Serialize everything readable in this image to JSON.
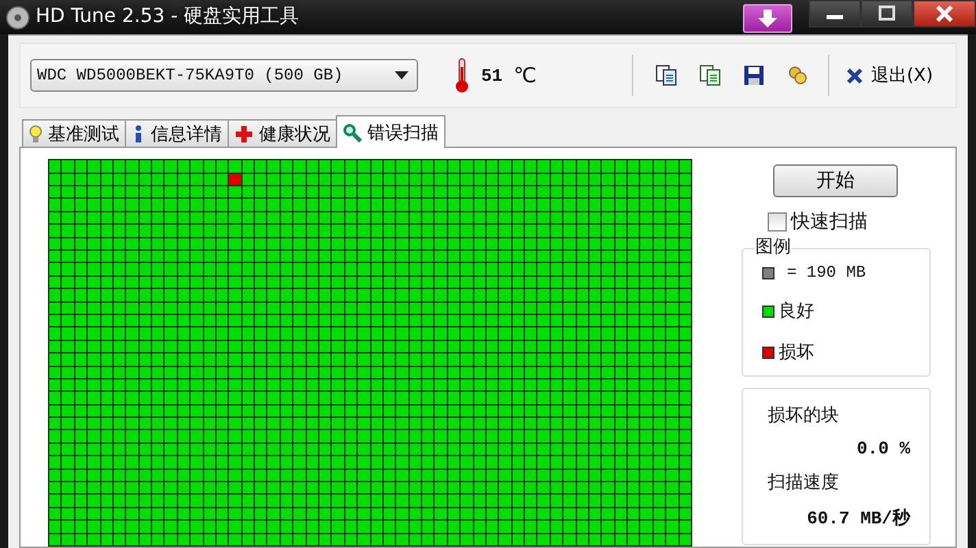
{
  "window": {
    "title": "HD Tune 2.53 - 硬盘实用工具"
  },
  "toolbar": {
    "drive": "WDC WD5000BEKT-75KA9T0 (500 GB)",
    "temperature": "51",
    "temperature_unit": "℃",
    "exit": "退出(X)"
  },
  "tabs": [
    {
      "label": "基准测试",
      "kind": "bulb",
      "selected": false
    },
    {
      "label": "信息详情",
      "kind": "info",
      "selected": false
    },
    {
      "label": "健康状况",
      "kind": "health",
      "selected": false
    },
    {
      "label": "错误扫描",
      "kind": "scan",
      "selected": true
    }
  ],
  "scan": {
    "start_button": "开始",
    "quick_scan": {
      "label": "快速扫描",
      "checked": false
    },
    "legend": {
      "title": "图例",
      "items": [
        {
          "kind": "size",
          "label": "= 190 MB",
          "color": "#808080"
        },
        {
          "kind": "good",
          "label": "良好",
          "color": "#00e000"
        },
        {
          "kind": "damaged",
          "label": "损坏",
          "color": "#e00000"
        }
      ]
    },
    "stats": [
      {
        "label": "损坏的块",
        "value": "0.0 %"
      },
      {
        "label": "扫描速度",
        "value": "60.7 MB/秒"
      }
    ],
    "block_rows": [
      [
        false,
        false,
        false,
        false,
        false,
        false,
        false,
        false,
        false,
        false,
        false,
        false,
        false,
        false,
        false,
        false,
        false,
        false,
        false,
        false,
        false,
        false,
        false,
        false,
        false,
        false,
        false,
        false,
        false,
        false,
        false,
        false,
        false,
        false,
        false,
        false,
        false,
        false,
        false,
        false,
        false,
        false,
        false,
        false,
        false,
        false,
        false,
        false,
        false,
        false
      ],
      [
        false,
        false,
        false,
        false,
        false,
        false,
        false,
        false,
        false,
        false,
        false,
        false,
        false,
        false,
        true,
        false,
        false,
        false,
        false,
        false,
        false,
        false,
        false,
        false,
        false,
        false,
        false,
        false,
        false,
        false,
        false,
        false,
        false,
        false,
        false,
        false,
        false,
        false,
        false,
        false,
        false,
        false,
        false,
        false,
        false,
        false,
        false,
        false,
        false,
        false
      ],
      [
        false,
        false,
        false,
        false,
        false,
        false,
        false,
        false,
        false,
        false,
        false,
        false,
        false,
        false,
        false,
        false,
        false,
        false,
        false,
        false,
        false,
        false,
        false,
        false,
        false,
        false,
        false,
        false,
        false,
        false,
        false,
        false,
        false,
        false,
        false,
        false,
        false,
        false,
        false,
        false,
        false,
        false,
        false,
        false,
        false,
        false,
        false,
        false,
        false,
        false
      ],
      [
        false,
        false,
        false,
        false,
        false,
        false,
        false,
        false,
        false,
        false,
        false,
        false,
        false,
        false,
        false,
        false,
        false,
        false,
        false,
        false,
        false,
        false,
        false,
        false,
        false,
        false,
        false,
        false,
        false,
        false,
        false,
        false,
        false,
        false,
        false,
        false,
        false,
        false,
        false,
        false,
        false,
        false,
        false,
        false,
        false,
        false,
        false,
        false,
        false,
        false
      ],
      [
        false,
        false,
        false,
        false,
        false,
        false,
        false,
        false,
        false,
        false,
        false,
        false,
        false,
        false,
        false,
        false,
        false,
        false,
        false,
        false,
        false,
        false,
        false,
        false,
        false,
        false,
        false,
        false,
        false,
        false,
        false,
        false,
        false,
        false,
        false,
        false,
        false,
        false,
        false,
        false,
        false,
        false,
        false,
        false,
        false,
        false,
        false,
        false,
        false,
        false
      ],
      [
        false,
        false,
        false,
        false,
        false,
        false,
        false,
        false,
        false,
        false,
        false,
        false,
        false,
        false,
        false,
        false,
        false,
        false,
        false,
        false,
        false,
        false,
        false,
        false,
        false,
        false,
        false,
        false,
        false,
        false,
        false,
        false,
        false,
        false,
        false,
        false,
        false,
        false,
        false,
        false,
        false,
        false,
        false,
        false,
        false,
        false,
        false,
        false,
        false,
        false
      ],
      [
        false,
        false,
        false,
        false,
        false,
        false,
        false,
        false,
        false,
        false,
        false,
        false,
        false,
        false,
        false,
        false,
        false,
        false,
        false,
        false,
        false,
        false,
        false,
        false,
        false,
        false,
        false,
        false,
        false,
        false,
        false,
        false,
        false,
        false,
        false,
        false,
        false,
        false,
        false,
        false,
        false,
        false,
        false,
        false,
        false,
        false,
        false,
        false,
        false,
        false
      ],
      [
        false,
        false,
        false,
        false,
        false,
        false,
        false,
        false,
        false,
        false,
        false,
        false,
        false,
        false,
        false,
        false,
        false,
        false,
        false,
        false,
        false,
        false,
        false,
        false,
        false,
        false,
        false,
        false,
        false,
        false,
        false,
        false,
        false,
        false,
        false,
        false,
        false,
        false,
        false,
        false,
        false,
        false,
        false,
        false,
        false,
        false,
        false,
        false,
        false,
        false
      ],
      [
        false,
        false,
        false,
        false,
        false,
        false,
        false,
        false,
        false,
        false,
        false,
        false,
        false,
        false,
        false,
        false,
        false,
        false,
        false,
        false,
        false,
        false,
        false,
        false,
        false,
        false,
        false,
        false,
        false,
        false,
        false,
        false,
        false,
        false,
        false,
        false,
        false,
        false,
        false,
        false,
        false,
        false,
        false,
        false,
        false,
        false,
        false,
        false,
        false,
        false
      ],
      [
        false,
        false,
        false,
        false,
        false,
        false,
        false,
        false,
        false,
        false,
        false,
        false,
        false,
        false,
        false,
        false,
        false,
        false,
        false,
        false,
        false,
        false,
        false,
        false,
        false,
        false,
        false,
        false,
        false,
        false,
        false,
        false,
        false,
        false,
        false,
        false,
        false,
        false,
        false,
        false,
        false,
        false,
        false,
        false,
        false,
        false,
        false,
        false,
        false,
        false
      ],
      [
        false,
        false,
        false,
        false,
        false,
        false,
        false,
        false,
        false,
        false,
        false,
        false,
        false,
        false,
        false,
        false,
        false,
        false,
        false,
        false,
        false,
        false,
        false,
        false,
        false,
        false,
        false,
        false,
        false,
        false,
        false,
        false,
        false,
        false,
        false,
        false,
        false,
        false,
        false,
        false,
        false,
        false,
        false,
        false,
        false,
        false,
        false,
        false,
        false,
        false
      ],
      [
        false,
        false,
        false,
        false,
        false,
        false,
        false,
        false,
        false,
        false,
        false,
        false,
        false,
        false,
        false,
        false,
        false,
        false,
        false,
        false,
        false,
        false,
        false,
        false,
        false,
        false,
        false,
        false,
        false,
        false,
        false,
        false,
        false,
        false,
        false,
        false,
        false,
        false,
        false,
        false,
        false,
        false,
        false,
        false,
        false,
        false,
        false,
        false,
        false,
        false
      ],
      [
        false,
        false,
        false,
        false,
        false,
        false,
        false,
        false,
        false,
        false,
        false,
        false,
        false,
        false,
        false,
        false,
        false,
        false,
        false,
        false,
        false,
        false,
        false,
        false,
        false,
        false,
        false,
        false,
        false,
        false,
        false,
        false,
        false,
        false,
        false,
        false,
        false,
        false,
        false,
        false,
        false,
        false,
        false,
        false,
        false,
        false,
        false,
        false,
        false,
        false
      ],
      [
        false,
        false,
        false,
        false,
        false,
        false,
        false,
        false,
        false,
        false,
        false,
        false,
        false,
        false,
        false,
        false,
        false,
        false,
        false,
        false,
        false,
        false,
        false,
        false,
        false,
        false,
        false,
        false,
        false,
        false,
        false,
        false,
        false,
        false,
        false,
        false,
        false,
        false,
        false,
        false,
        false,
        false,
        false,
        false,
        false,
        false,
        false,
        false,
        false,
        false
      ],
      [
        false,
        false,
        false,
        false,
        false,
        false,
        false,
        false,
        false,
        false,
        false,
        false,
        false,
        false,
        false,
        false,
        false,
        false,
        false,
        false,
        false,
        false,
        false,
        false,
        false,
        false,
        false,
        false,
        false,
        false,
        false,
        false,
        false,
        false,
        false,
        false,
        false,
        false,
        false,
        false,
        false,
        false,
        false,
        false,
        false,
        false,
        false,
        false,
        false,
        false
      ],
      [
        false,
        false,
        false,
        false,
        false,
        false,
        false,
        false,
        false,
        false,
        false,
        false,
        false,
        false,
        false,
        false,
        false,
        false,
        false,
        false,
        false,
        false,
        false,
        false,
        false,
        false,
        false,
        false,
        false,
        false,
        false,
        false,
        false,
        false,
        false,
        false,
        false,
        false,
        false,
        false,
        false,
        false,
        false,
        false,
        false,
        false,
        false,
        false,
        false,
        false
      ],
      [
        false,
        false,
        false,
        false,
        false,
        false,
        false,
        false,
        false,
        false,
        false,
        false,
        false,
        false,
        false,
        false,
        false,
        false,
        false,
        false,
        false,
        false,
        false,
        false,
        false,
        false,
        false,
        false,
        false,
        false,
        false,
        false,
        false,
        false,
        false,
        false,
        false,
        false,
        false,
        false,
        false,
        false,
        false,
        false,
        false,
        false,
        false,
        false,
        false,
        false
      ],
      [
        false,
        false,
        false,
        false,
        false,
        false,
        false,
        false,
        false,
        false,
        false,
        false,
        false,
        false,
        false,
        false,
        false,
        false,
        false,
        false,
        false,
        false,
        false,
        false,
        false,
        false,
        false,
        false,
        false,
        false,
        false,
        false,
        false,
        false,
        false,
        false,
        false,
        false,
        false,
        false,
        false,
        false,
        false,
        false,
        false,
        false,
        false,
        false,
        false,
        false
      ],
      [
        false,
        false,
        false,
        false,
        false,
        false,
        false,
        false,
        false,
        false,
        false,
        false,
        false,
        false,
        false,
        false,
        false,
        false,
        false,
        false,
        false,
        false,
        false,
        false,
        false,
        false,
        false,
        false,
        false,
        false,
        false,
        false,
        false,
        false,
        false,
        false,
        false,
        false,
        false,
        false,
        false,
        false,
        false,
        false,
        false,
        false,
        false,
        false,
        false,
        false
      ],
      [
        false,
        false,
        false,
        false,
        false,
        false,
        false,
        false,
        false,
        false,
        false,
        false,
        false,
        false,
        false,
        false,
        false,
        false,
        false,
        false,
        false,
        false,
        false,
        false,
        false,
        false,
        false,
        false,
        false,
        false,
        false,
        false,
        false,
        false,
        false,
        false,
        false,
        false,
        false,
        false,
        false,
        false,
        false,
        false,
        false,
        false,
        false,
        false,
        false,
        false
      ],
      [
        false,
        false,
        false,
        false,
        false,
        false,
        false,
        false,
        false,
        false,
        false,
        false,
        false,
        false,
        false,
        false,
        false,
        false,
        false,
        false,
        false,
        false,
        false,
        false,
        false,
        false,
        false,
        false,
        false,
        false,
        false,
        false,
        false,
        false,
        false,
        false,
        false,
        false,
        false,
        false,
        false,
        false,
        false,
        false,
        false,
        false,
        false,
        false,
        false,
        false
      ],
      [
        false,
        false,
        false,
        false,
        false,
        false,
        false,
        false,
        false,
        false,
        false,
        false,
        false,
        false,
        false,
        false,
        false,
        false,
        false,
        false,
        false,
        false,
        false,
        false,
        false,
        false,
        false,
        false,
        false,
        false,
        false,
        false,
        false,
        false,
        false,
        false,
        false,
        false,
        false,
        false,
        false,
        false,
        false,
        false,
        false,
        false,
        false,
        false,
        false,
        false
      ],
      [
        false,
        false,
        false,
        false,
        false,
        false,
        false,
        false,
        false,
        false,
        false,
        false,
        false,
        false,
        false,
        false,
        false,
        false,
        false,
        false,
        false,
        false,
        false,
        false,
        false,
        false,
        false,
        false,
        false,
        false,
        false,
        false,
        false,
        false,
        false,
        false,
        false,
        false,
        false,
        false,
        false,
        false,
        false,
        false,
        false,
        false,
        false,
        false,
        false,
        false
      ],
      [
        false,
        false,
        false,
        false,
        false,
        false,
        false,
        false,
        false,
        false,
        false,
        false,
        false,
        false,
        false,
        false,
        false,
        false,
        false,
        false,
        false,
        false,
        false,
        false,
        false,
        false,
        false,
        false,
        false,
        false,
        false,
        false,
        false,
        false,
        false,
        false,
        false,
        false,
        false,
        false,
        false,
        false,
        false,
        false,
        false,
        false,
        false,
        false,
        false,
        false
      ],
      [
        false,
        false,
        false,
        false,
        false,
        false,
        false,
        false,
        false,
        false,
        false,
        false,
        false,
        false,
        false,
        false,
        false,
        false,
        false,
        false,
        false,
        false,
        false,
        false,
        false,
        false,
        false,
        false,
        false,
        false,
        false,
        false,
        false,
        false,
        false,
        false,
        false,
        false,
        false,
        false,
        false,
        false,
        false,
        false,
        false,
        false,
        false,
        false,
        false,
        false
      ],
      [
        false,
        false,
        false,
        false,
        false,
        false,
        false,
        false,
        false,
        false,
        false,
        false,
        false,
        false,
        false,
        false,
        false,
        false,
        false,
        false,
        false,
        false,
        false,
        false,
        false,
        false,
        false,
        false,
        false,
        false,
        false,
        false,
        false,
        false,
        false,
        false,
        false,
        false,
        false,
        false,
        false,
        false,
        false,
        false,
        false,
        false,
        false,
        false,
        false,
        false
      ],
      [
        false,
        false,
        false,
        false,
        false,
        false,
        false,
        false,
        false,
        false,
        false,
        false,
        false,
        false,
        false,
        false,
        false,
        false,
        false,
        false,
        false,
        false,
        false,
        false,
        false,
        false,
        false,
        false,
        false,
        false,
        false,
        false,
        false,
        false,
        false,
        false,
        false,
        false,
        false,
        false,
        false,
        false,
        false,
        false,
        false,
        false,
        false,
        false,
        false,
        false
      ],
      [
        false,
        false,
        false,
        false,
        false,
        false,
        false,
        false,
        false,
        false,
        false,
        false,
        false,
        false,
        false,
        false,
        false,
        false,
        false,
        false,
        false,
        false,
        false,
        false,
        false,
        false,
        false,
        false,
        false,
        false,
        false,
        false,
        false,
        false,
        false,
        false,
        false,
        false,
        false,
        false,
        false,
        false,
        false,
        false,
        false,
        false,
        false,
        false,
        false,
        false
      ],
      [
        false,
        false,
        false,
        false,
        false,
        false,
        false,
        false,
        false,
        false,
        false,
        false,
        false,
        false,
        false,
        false,
        false,
        false,
        false,
        false,
        false,
        false,
        false,
        false,
        false,
        false,
        false,
        false,
        false,
        false,
        false,
        false,
        false,
        false,
        false,
        false,
        false,
        false,
        false,
        false,
        false,
        false,
        false,
        false,
        false,
        false,
        false,
        false,
        false,
        false
      ],
      [
        false,
        false,
        false,
        false,
        false,
        false,
        false,
        false,
        false,
        false,
        false,
        false,
        false,
        false,
        false,
        false,
        false,
        false,
        false,
        false,
        false,
        false,
        false,
        false,
        false,
        false,
        false,
        false,
        false,
        false,
        false,
        false,
        false,
        false,
        false,
        false,
        false,
        false,
        false,
        false,
        false,
        false,
        false,
        false,
        false,
        false,
        false,
        false,
        false,
        false
      ]
    ]
  }
}
